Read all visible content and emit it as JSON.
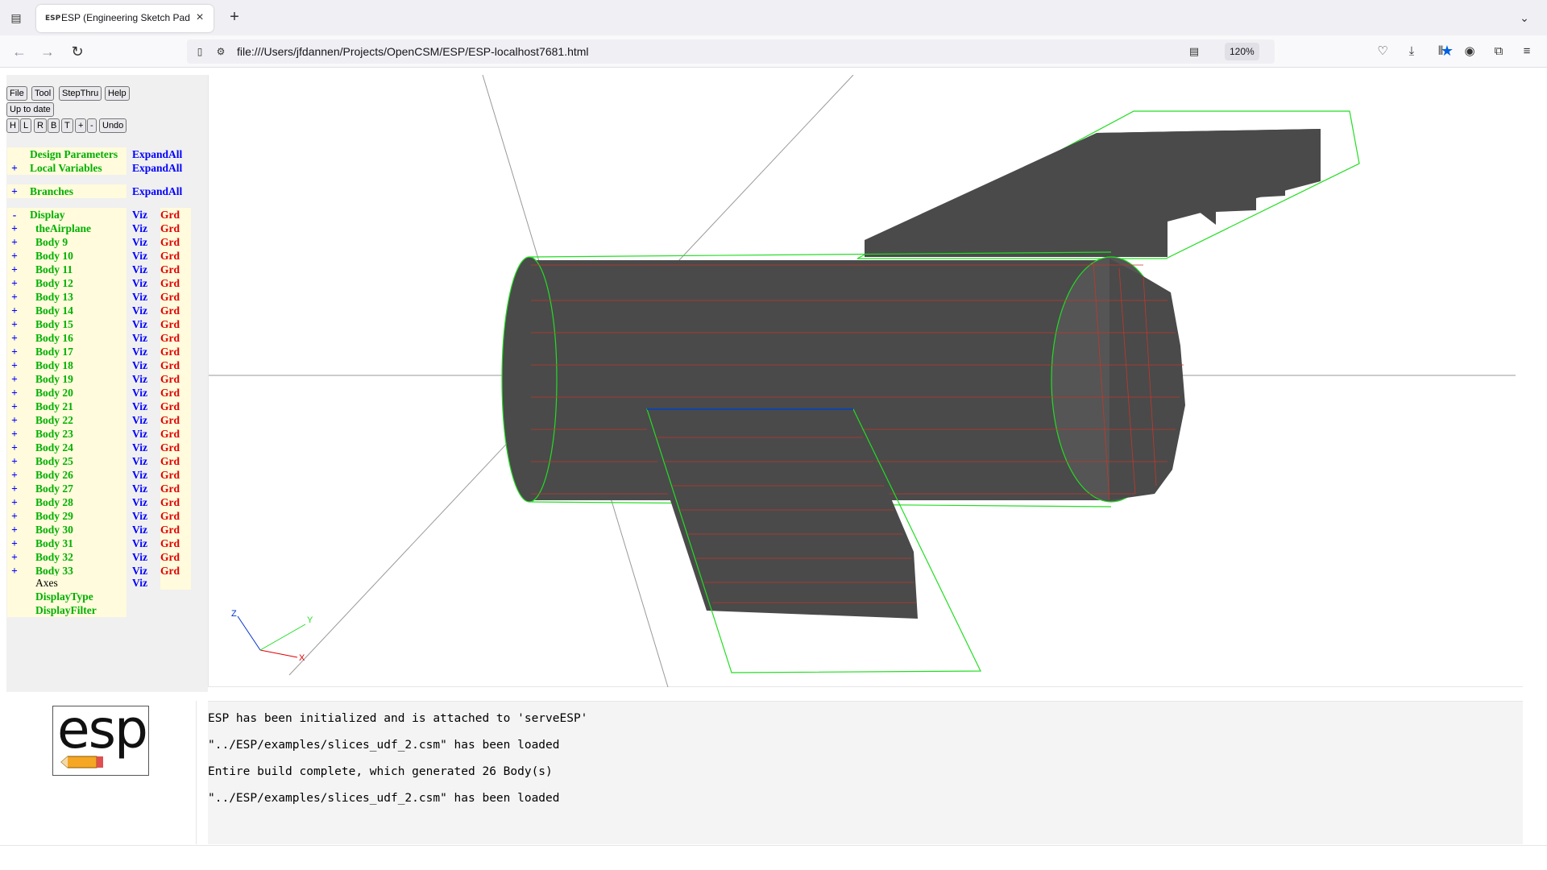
{
  "browser": {
    "tab_title": "ESP (Engineering Sketch Pad, V",
    "favicon_text": "ESP",
    "url": "file:///Users/jfdannen/Projects/OpenCSM/ESP/ESP-localhost7681.html",
    "zoom": "120%",
    "accent_color": "#0061e0"
  },
  "toolbar": {
    "file": "File",
    "tool": "Tool",
    "stepthru": "StepThru",
    "help": "Help",
    "status": "Up to date",
    "view_buttons": [
      "H",
      "L",
      "R",
      "B",
      "T",
      "+",
      "-"
    ],
    "undo": "Undo"
  },
  "tree": {
    "design_parameters": {
      "label": "Design Parameters",
      "action": "ExpandAll"
    },
    "local_variables": {
      "pm": "+",
      "label": "Local Variables",
      "action": "ExpandAll"
    },
    "branches": {
      "pm": "+",
      "label": "Branches",
      "action": "ExpandAll"
    },
    "display": {
      "pm": "-",
      "label": "Display",
      "viz": "Viz",
      "grd": "Grd"
    },
    "bodies": [
      {
        "pm": "+",
        "label": "theAirplane",
        "viz": "Viz",
        "grd": "Grd"
      },
      {
        "pm": "+",
        "label": "Body 9",
        "viz": "Viz",
        "grd": "Grd"
      },
      {
        "pm": "+",
        "label": "Body 10",
        "viz": "Viz",
        "grd": "Grd"
      },
      {
        "pm": "+",
        "label": "Body 11",
        "viz": "Viz",
        "grd": "Grd"
      },
      {
        "pm": "+",
        "label": "Body 12",
        "viz": "Viz",
        "grd": "Grd"
      },
      {
        "pm": "+",
        "label": "Body 13",
        "viz": "Viz",
        "grd": "Grd"
      },
      {
        "pm": "+",
        "label": "Body 14",
        "viz": "Viz",
        "grd": "Grd"
      },
      {
        "pm": "+",
        "label": "Body 15",
        "viz": "Viz",
        "grd": "Grd"
      },
      {
        "pm": "+",
        "label": "Body 16",
        "viz": "Viz",
        "grd": "Grd"
      },
      {
        "pm": "+",
        "label": "Body 17",
        "viz": "Viz",
        "grd": "Grd"
      },
      {
        "pm": "+",
        "label": "Body 18",
        "viz": "Viz",
        "grd": "Grd"
      },
      {
        "pm": "+",
        "label": "Body 19",
        "viz": "Viz",
        "grd": "Grd"
      },
      {
        "pm": "+",
        "label": "Body 20",
        "viz": "Viz",
        "grd": "Grd"
      },
      {
        "pm": "+",
        "label": "Body 21",
        "viz": "Viz",
        "grd": "Grd"
      },
      {
        "pm": "+",
        "label": "Body 22",
        "viz": "Viz",
        "grd": "Grd"
      },
      {
        "pm": "+",
        "label": "Body 23",
        "viz": "Viz",
        "grd": "Grd"
      },
      {
        "pm": "+",
        "label": "Body 24",
        "viz": "Viz",
        "grd": "Grd"
      },
      {
        "pm": "+",
        "label": "Body 25",
        "viz": "Viz",
        "grd": "Grd"
      },
      {
        "pm": "+",
        "label": "Body 26",
        "viz": "Viz",
        "grd": "Grd"
      },
      {
        "pm": "+",
        "label": "Body 27",
        "viz": "Viz",
        "grd": "Grd"
      },
      {
        "pm": "+",
        "label": "Body 28",
        "viz": "Viz",
        "grd": "Grd"
      },
      {
        "pm": "+",
        "label": "Body 29",
        "viz": "Viz",
        "grd": "Grd"
      },
      {
        "pm": "+",
        "label": "Body 30",
        "viz": "Viz",
        "grd": "Grd"
      },
      {
        "pm": "+",
        "label": "Body 31",
        "viz": "Viz",
        "grd": "Grd"
      },
      {
        "pm": "+",
        "label": "Body 32",
        "viz": "Viz",
        "grd": "Grd"
      },
      {
        "pm": "+",
        "label": "Body 33",
        "viz": "Viz",
        "grd": "Grd"
      }
    ],
    "axes": {
      "label": "Axes",
      "viz": "Viz"
    },
    "display_type": "DisplayType",
    "display_filter": "DisplayFilter",
    "colors": {
      "parameter_green": "#00b000",
      "viz_blue": "#0000ff",
      "grd_red": "#e00000",
      "cell_bg": "#fffbdc"
    }
  },
  "viewer": {
    "axis_labels": {
      "x": "X",
      "y": "Y",
      "z": "Z"
    },
    "colors": {
      "face": "#4a4a4a",
      "edge": "#c0392b",
      "bbox": "#22dd22",
      "selected_edge": "#0033cc"
    }
  },
  "logo_text": "esp",
  "messages": [
    "ESP has been initialized and is attached to 'serveESP'",
    "\"../ESP/examples/slices_udf_2.csm\" has been loaded",
    "Entire build complete, which generated 26 Body(s)",
    "\"../ESP/examples/slices_udf_2.csm\" has been loaded"
  ]
}
